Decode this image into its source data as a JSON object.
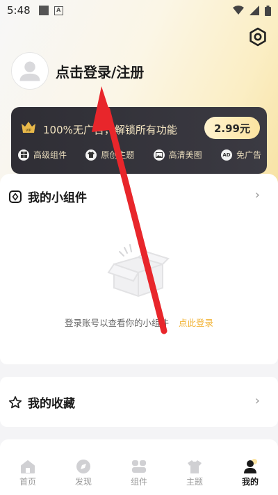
{
  "status_bar": {
    "time": "5:48"
  },
  "profile": {
    "login_text": "点击登录/注册"
  },
  "vip": {
    "title": "100%无广告，解锁所有功能",
    "price": "2.99元",
    "features": [
      {
        "label": "高级组件",
        "icon": "grid-icon"
      },
      {
        "label": "原创主题",
        "icon": "theme-icon"
      },
      {
        "label": "高清美图",
        "icon": "image-icon"
      },
      {
        "label": "免广告",
        "icon_text": "AD",
        "icon": "ad-icon"
      }
    ]
  },
  "widgets": {
    "title": "我的小组件",
    "empty_text": "登录账号以查看你的小组件",
    "empty_link": "点此登录"
  },
  "favorites": {
    "title": "我的收藏"
  },
  "tabs": [
    {
      "label": "首页",
      "icon": "home-icon"
    },
    {
      "label": "发现",
      "icon": "discover-icon"
    },
    {
      "label": "组件",
      "icon": "widgets-icon"
    },
    {
      "label": "主题",
      "icon": "shirt-icon"
    },
    {
      "label": "我的",
      "icon": "profile-icon",
      "active": true
    }
  ],
  "colors": {
    "accent": "#f2b335",
    "vip_card": "#34333a",
    "annotation_arrow": "#e8262b"
  }
}
